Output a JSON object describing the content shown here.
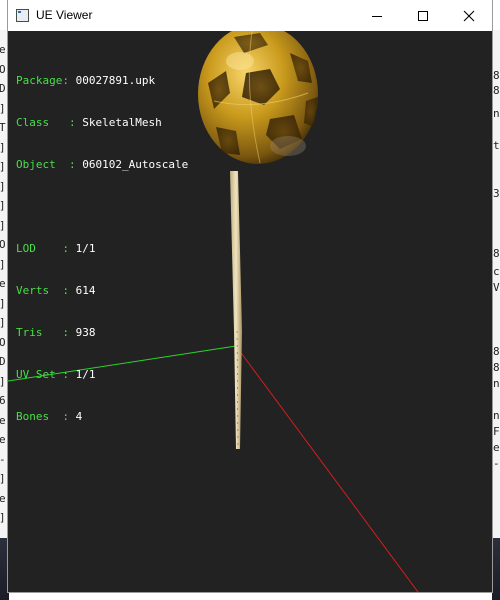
{
  "window": {
    "title": "UE Viewer",
    "controls": {
      "minimize": "minimize",
      "maximize": "maximize",
      "close": "close"
    }
  },
  "info": {
    "package": {
      "label": "Package: ",
      "value": "00027891.upk"
    },
    "class": {
      "label": "Class   : ",
      "value": "SkeletalMesh"
    },
    "object": {
      "label": "Object  : ",
      "value": "060102_Autoscale"
    },
    "lod": {
      "label": "LOD    : ",
      "value": "1/1"
    },
    "verts": {
      "label": "Verts  : ",
      "value": "614"
    },
    "tris": {
      "label": "Tris   : ",
      "value": "938"
    },
    "uvset": {
      "label": "UV Set : ",
      "value": "1/1"
    },
    "bones": {
      "label": "Bones  : ",
      "value": "4"
    }
  },
  "colors": {
    "viewport_bg": "#222222",
    "info_label": "#4ade4a",
    "axis_x": "#d21e1e",
    "axis_y": "#2ad42a",
    "axis_z": "#2b2bd8",
    "ball_gold": "#d9a520",
    "ball_dark": "#3a2808",
    "stick": "#e2d3a8"
  },
  "background_window": {
    "left_chars": [
      "e",
      "O",
      "D",
      "]",
      "T",
      "]",
      "]",
      "]",
      "]",
      "]",
      "O",
      "]",
      "e",
      "]",
      "]",
      "O",
      "D",
      "]",
      "6",
      "e",
      "e",
      "-",
      "]",
      "e",
      "]"
    ],
    "right_chars": [
      "8",
      "8",
      "n",
      "t",
      "3",
      "8",
      "c",
      "V",
      "8",
      "8",
      "n",
      "n",
      "F",
      "e",
      "-"
    ]
  }
}
